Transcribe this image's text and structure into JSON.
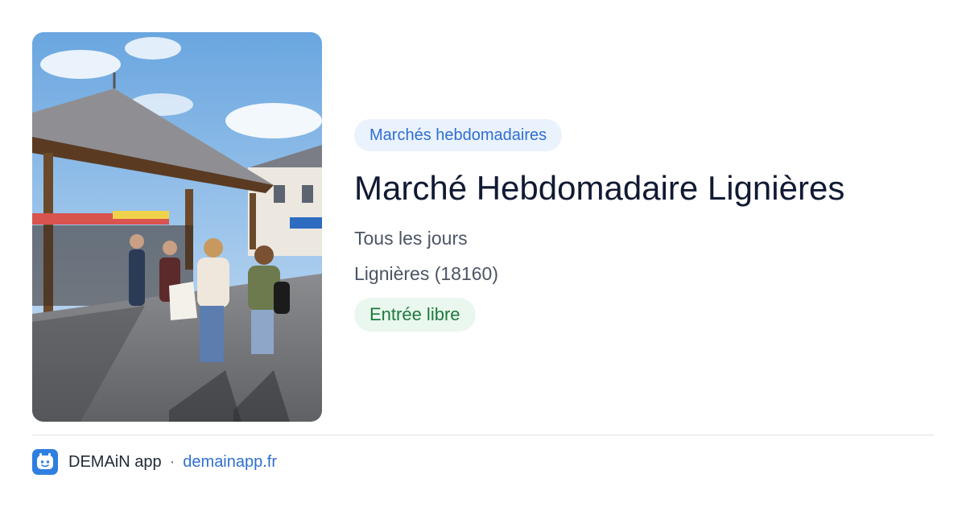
{
  "event": {
    "category": "Marchés hebdomadaires",
    "title": "Marché Hebdomadaire Lignières",
    "schedule": "Tous les jours",
    "location": "Lignières (18160)",
    "access": "Entrée libre"
  },
  "footer": {
    "app_name": "DEMAiN app",
    "separator": "·",
    "url": "demainapp.fr"
  },
  "colors": {
    "category_chip_bg": "#eaf2fd",
    "category_chip_text": "#2f6fd0",
    "access_chip_bg": "#eaf7ee",
    "access_chip_text": "#1e7a3c",
    "brand_blue": "#2e7fe0"
  },
  "icons": {
    "app_logo": "demain-logo-icon"
  }
}
